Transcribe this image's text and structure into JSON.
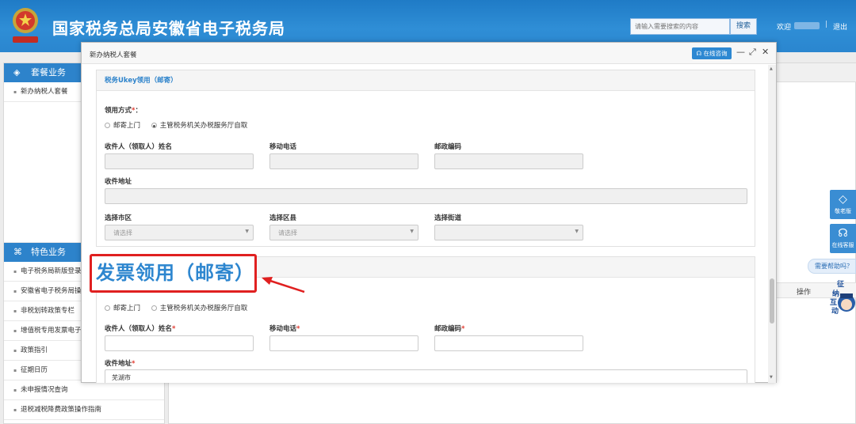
{
  "header": {
    "site_title": "国家税务总局安徽省电子税务局",
    "search_placeholder": "请输入需要搜索的内容",
    "search_button": "搜索",
    "welcome": "欢迎",
    "separator": "|",
    "logout": "退出"
  },
  "sidebar": {
    "package_section": "套餐业务",
    "package_items": [
      "新办纳税人套餐"
    ],
    "special_section": "特色业务",
    "special_items": [
      "电子税务局新版登录",
      "安徽省电子税务局操",
      "非税划转政策专栏",
      "增值税专用发票电子",
      "政策指引",
      "征期日历",
      "未申报情况查询",
      "退税减税降费政策操作指南"
    ]
  },
  "right_tools": {
    "elder_label": "敬老版",
    "online_label": "在线客服",
    "help_bubble": "需要帮助吗？",
    "mascot_text": [
      "征",
      "纳",
      "互",
      "动"
    ]
  },
  "main": {
    "op_column": "操作"
  },
  "modal": {
    "title": "新办纳税人套餐",
    "consult_button": "在线咨询",
    "section1": {
      "title": "税务Ukey领用（邮寄）",
      "method_label": "领用方式",
      "method_suffix": "：",
      "options": [
        "邮寄上门",
        "主管税务机关办税服务厅自取"
      ],
      "selected": "主管税务机关办税服务厅自取",
      "recipient_label": "收件人（领取人）姓名",
      "phone_label": "移动电话",
      "postcode_label": "邮政编码",
      "address_label": "收件地址",
      "city_label": "选择市区",
      "district_label": "选择区县",
      "street_label": "选择街道",
      "city_placeholder": "请选择",
      "district_placeholder": "请选择",
      "street_placeholder": ""
    },
    "section2": {
      "options": [
        "邮寄上门",
        "主管税务机关办税服务厅自取"
      ],
      "selected": "",
      "recipient_label": "收件人（领取人）姓名",
      "phone_label": "移动电话",
      "postcode_label": "邮政编码",
      "address_label": "收件地址",
      "address_value": "芜湖市"
    }
  },
  "annotation": {
    "text": "发票领用（邮寄）",
    "color": "#e02020"
  },
  "colors": {
    "header_blue": "#2a86cf",
    "accent_blue": "#2d83cb",
    "required_red": "#e03c31"
  }
}
